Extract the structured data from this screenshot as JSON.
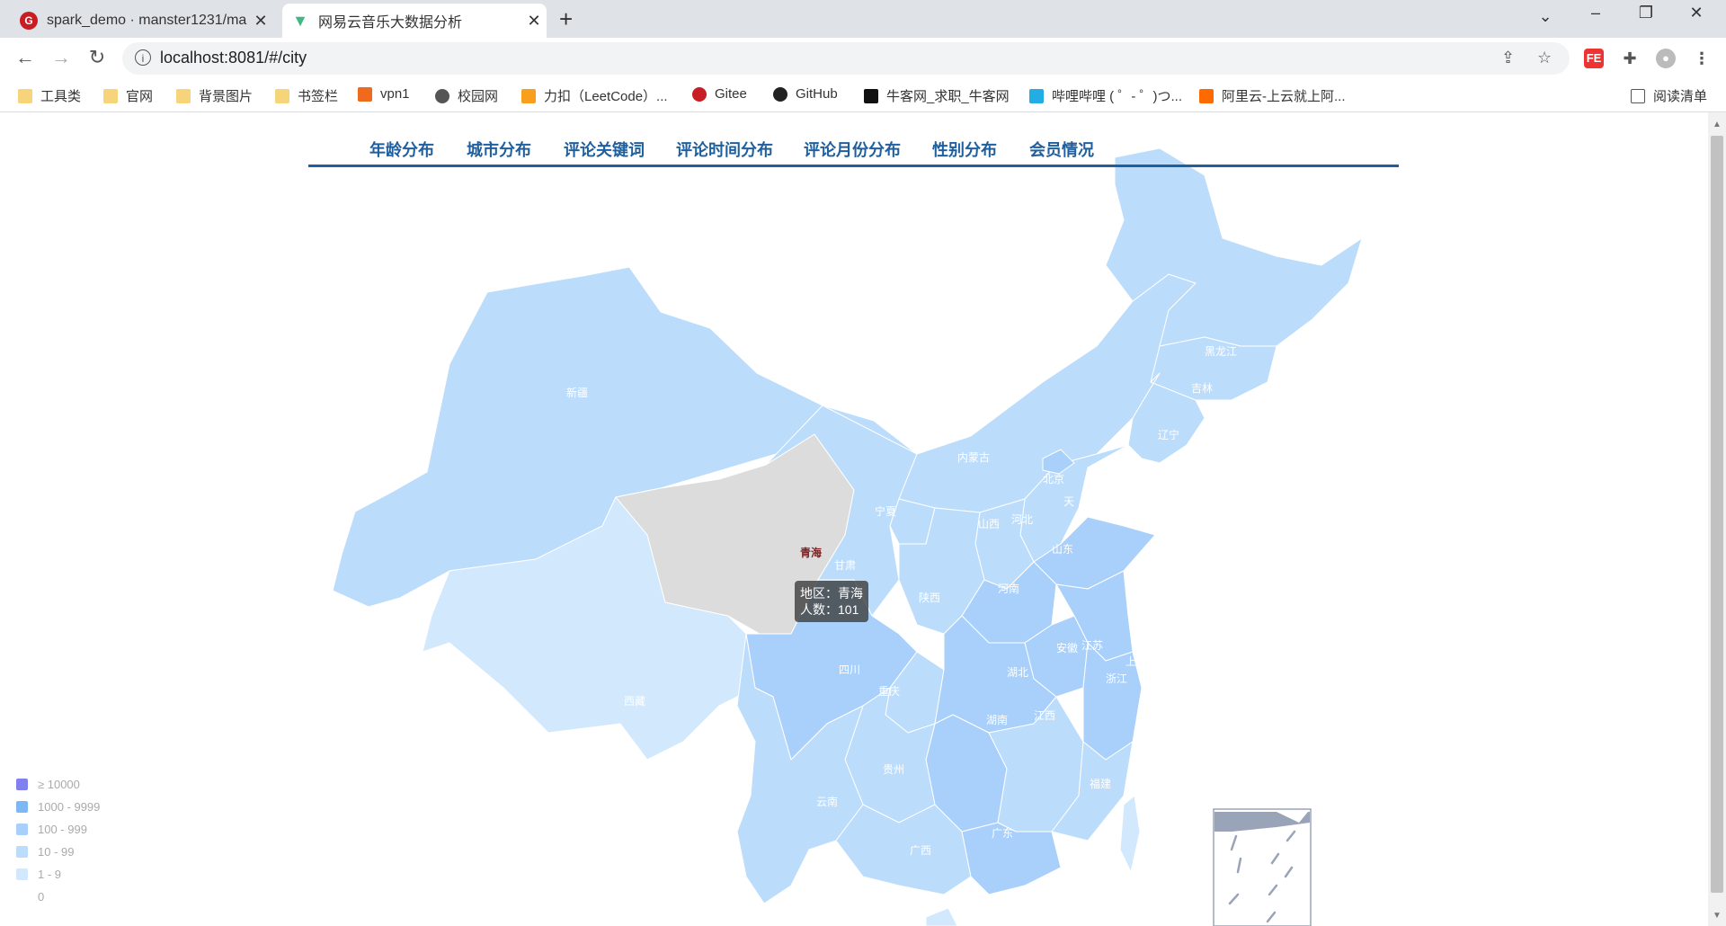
{
  "tabs": [
    {
      "title": "spark_demo · manster1231/ma",
      "active": false
    },
    {
      "title": "网易云音乐大数据分析",
      "active": true
    }
  ],
  "address": {
    "url": "localhost:8081/#/city"
  },
  "bookmarks": [
    "工具类",
    "官网",
    "背景图片",
    "书签栏",
    "vpn1",
    "校园网",
    "力扣（LeetCode）...",
    "Gitee",
    "GitHub",
    "牛客网_求职_牛客网",
    "哔哩哔哩 ( ゜- ゜)つ...",
    "阿里云-上云就上阿...",
    "阅读清单"
  ],
  "nav": [
    "年龄分布",
    "城市分布",
    "评论关键词",
    "评论时间分布",
    "评论月份分布",
    "性别分布",
    "会员情况"
  ],
  "map_labels": {
    "xinjiang": "新疆",
    "xizang": "西藏",
    "qinghai": "青海",
    "gansu": "甘肃",
    "neimenggu": "内蒙古",
    "heilongjiang": "黑龙江",
    "jilin": "吉林",
    "liaoning": "辽宁",
    "beijing": "北京",
    "tianjin": "天",
    "hebei": "河北",
    "shanxi": "山西",
    "ningxia": "宁夏",
    "shandong": "山东",
    "henan": "河南",
    "shaanxi": "陕西",
    "sichuan": "四川",
    "chongqing": "重庆",
    "hubei": "湖北",
    "anhui": "安徽",
    "jiangsu": "江苏",
    "shanghai": "上",
    "zhejiang": "浙江",
    "hunan": "湖南",
    "jiangxi": "江西",
    "guizhou": "贵州",
    "yunnan": "云南",
    "guangxi": "广西",
    "guangdong": "广东",
    "fujian": "福建"
  },
  "legend": [
    {
      "label": "≥ 10000",
      "color": "#8080f0"
    },
    {
      "label": "1000 - 9999",
      "color": "#7db8f5"
    },
    {
      "label": "100 - 999",
      "color": "#a8d0fa"
    },
    {
      "label": "10 - 99",
      "color": "#bcdcfb"
    },
    {
      "label": "1 - 9",
      "color": "#d2e8fd"
    },
    {
      "label": "0",
      "color": "#ffffff"
    }
  ],
  "tooltip": {
    "line1": "地区：青海",
    "line2": "人数：101"
  },
  "colors": {
    "accent": "#1f5f9e",
    "hover_region": "#dcdcdc"
  }
}
